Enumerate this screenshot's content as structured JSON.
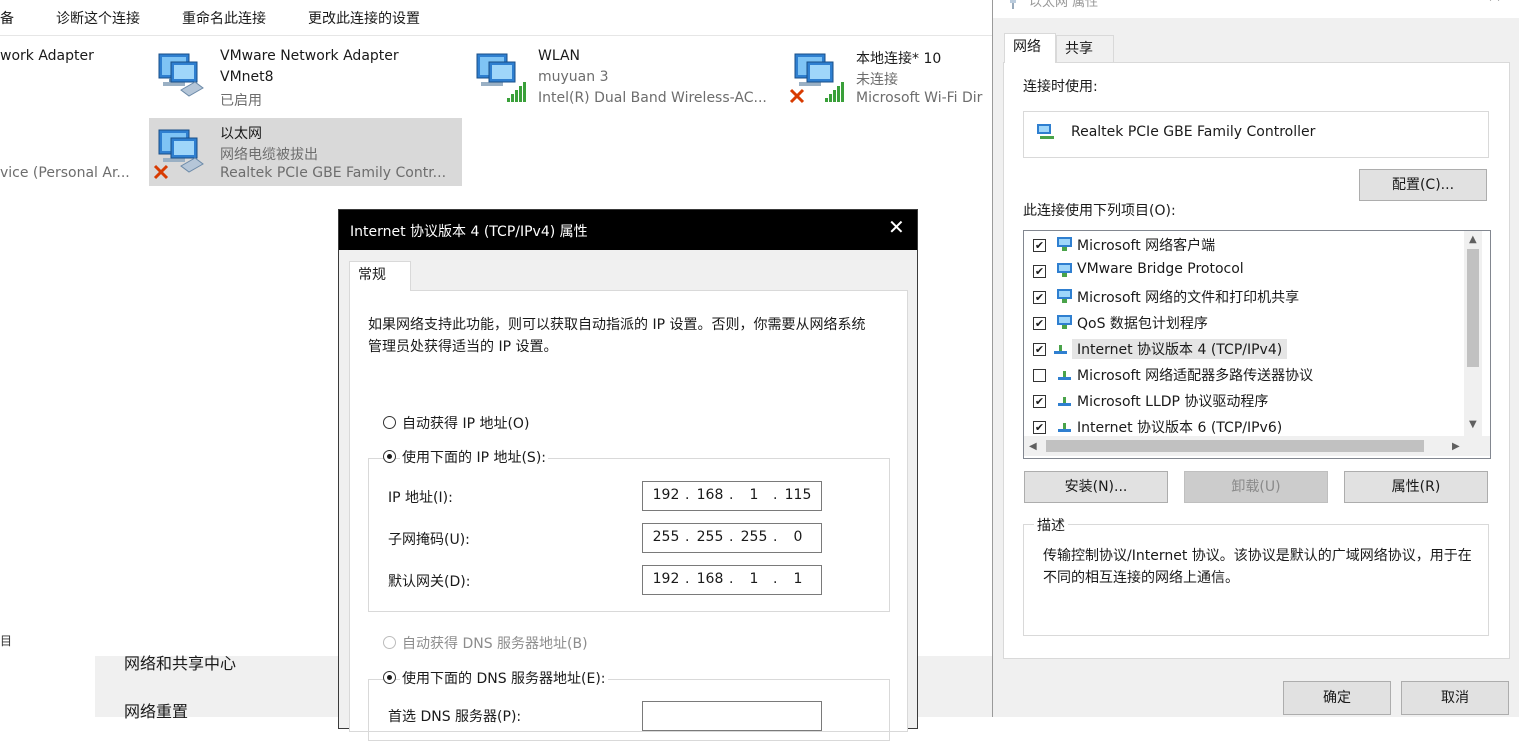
{
  "explorer": {
    "toolbar": [
      "设备",
      "诊断这个连接",
      "重命名此连接",
      "更改此连接的设置"
    ],
    "connections": [
      {
        "line1": "work Adapter",
        "line2": "",
        "line3": ""
      },
      {
        "line1": "VMware Network Adapter",
        "line2": "VMnet8",
        "line3": "已启用"
      },
      {
        "line1": "WLAN",
        "line2": "muyuan 3",
        "line3": "Intel(R) Dual Band Wireless-AC..."
      },
      {
        "line1": "本地连接* 10",
        "line2": "未连接",
        "line3": "Microsoft Wi-Fi Dir"
      },
      {
        "line1": "以太网",
        "line2": "网络电缆被拔出",
        "line3": "Realtek PCIe GBE Family Contr..."
      },
      {
        "line1": "vice (Personal Ar...",
        "line2": "",
        "line3": ""
      }
    ],
    "status_fragment": "目",
    "nav_links": [
      "网络和共享中心",
      "网络重置"
    ]
  },
  "ethernet_props": {
    "title": "以太网 属性",
    "tabs": [
      "网络",
      "共享"
    ],
    "connect_using_label": "连接时使用:",
    "adapter_name": "Realtek PCIe GBE Family Controller",
    "configure_button": "配置(C)...",
    "items_label": "此连接使用下列项目(O):",
    "items": [
      {
        "name": "Microsoft 网络客户端",
        "checked": true,
        "icon": "network-client-icon"
      },
      {
        "name": "VMware Bridge Protocol",
        "checked": true,
        "icon": "network-client-icon"
      },
      {
        "name": "Microsoft 网络的文件和打印机共享",
        "checked": true,
        "icon": "network-client-icon"
      },
      {
        "name": "QoS 数据包计划程序",
        "checked": true,
        "icon": "network-client-icon"
      },
      {
        "name": "Internet 协议版本 4 (TCP/IPv4)",
        "checked": true,
        "icon": "protocol-icon"
      },
      {
        "name": "Microsoft 网络适配器多路传送器协议",
        "checked": false,
        "icon": "protocol-icon"
      },
      {
        "name": "Microsoft LLDP 协议驱动程序",
        "checked": true,
        "icon": "protocol-icon"
      },
      {
        "name": "Internet 协议版本 6 (TCP/IPv6)",
        "checked": true,
        "icon": "protocol-icon"
      }
    ],
    "install_button": "安装(N)...",
    "uninstall_button": "卸载(U)",
    "properties_button": "属性(R)",
    "description_label": "描述",
    "description_text": "传输控制协议/Internet 协议。该协议是默认的广域网络协议，用于在不同的相互连接的网络上通信。",
    "ok_button": "确定",
    "cancel_button": "取消"
  },
  "ipv4_props": {
    "title": "Internet 协议版本 4 (TCP/IPv4) 属性",
    "tab": "常规",
    "intro": "如果网络支持此功能，则可以获取自动指派的 IP 设置。否则，你需要从网络系统管理员处获得适当的 IP 设置。",
    "auto_ip_label": "自动获得 IP 地址(O)",
    "manual_ip_label": "使用下面的 IP 地址(S):",
    "ip_label": "IP 地址(I):",
    "ip": [
      "192",
      "168",
      "1",
      "115"
    ],
    "mask_label": "子网掩码(U):",
    "mask": [
      "255",
      "255",
      "255",
      "0"
    ],
    "gateway_label": "默认网关(D):",
    "gateway": [
      "192",
      "168",
      "1",
      "1"
    ],
    "auto_dns_label": "自动获得 DNS 服务器地址(B)",
    "manual_dns_label": "使用下面的 DNS 服务器地址(E):",
    "preferred_dns_label": "首选 DNS 服务器(P):"
  },
  "colors": {
    "selected_row": "#d9d9d9",
    "dialog_bg": "#f0f0f0",
    "titlebar_dark": "#000000",
    "signal_green": "#3aa03a",
    "error_red": "#d83b01"
  }
}
